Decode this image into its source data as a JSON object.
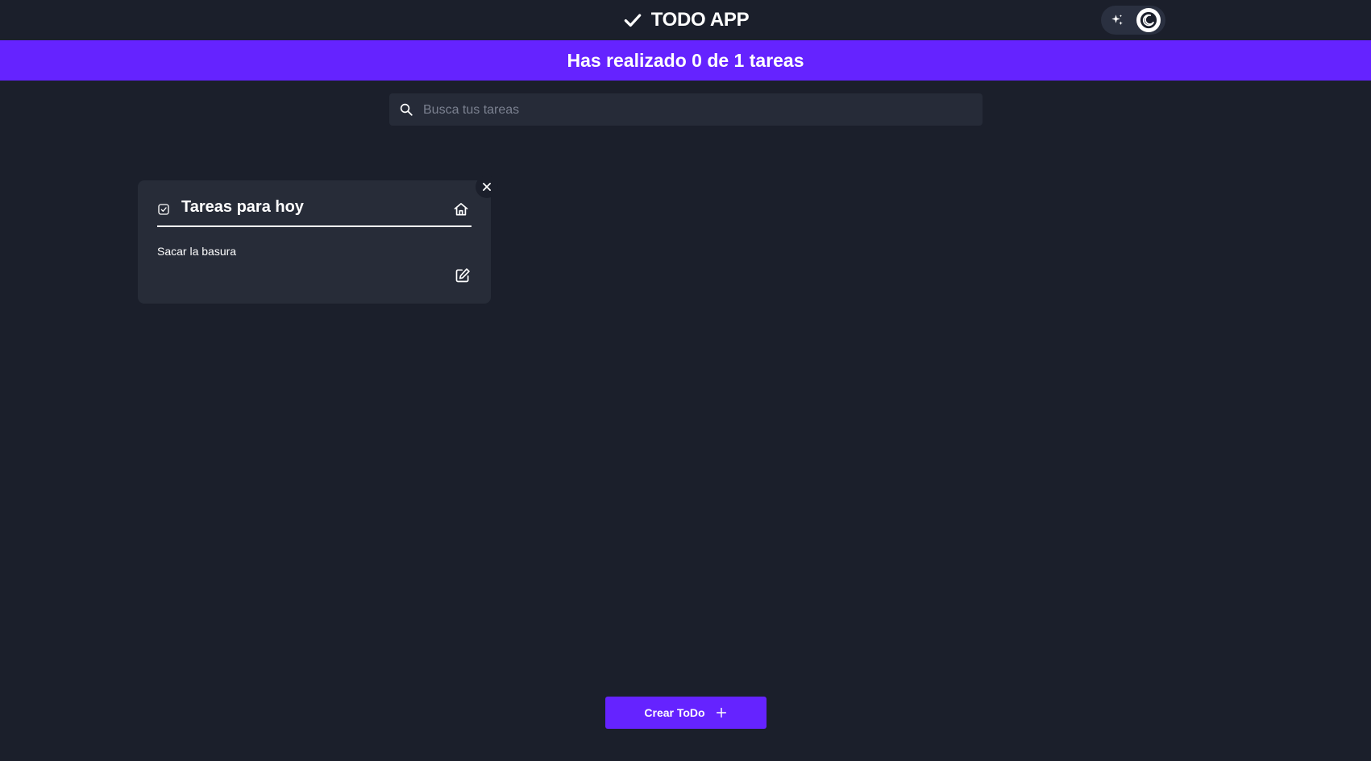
{
  "header": {
    "title": "TODO APP",
    "check_icon": "check-icon",
    "theme_toggle": {
      "light_icon": "sparkle-icon",
      "dark_icon": "moon-icon",
      "active": "dark"
    }
  },
  "progress": {
    "text": "Has realizado 0 de 1 tareas",
    "completed": 0,
    "total": 1
  },
  "search": {
    "placeholder": "Busca tus tareas",
    "value": "",
    "icon": "search-icon"
  },
  "todo_card": {
    "title": "Tareas para hoy",
    "category_icon": "home-icon",
    "status_icon": "checkbox-icon",
    "task": "Sacar la basura",
    "actions": {
      "edit_icon": "edit-icon",
      "delete_icon": "close-icon"
    }
  },
  "create_button": {
    "label": "Crear ToDo",
    "icon": "plus-icon"
  },
  "colors": {
    "background": "#1b1f2b",
    "accent": "#6523ff",
    "card": "#272c38",
    "search": "#262b38",
    "text": "#ffffff",
    "placeholder": "#7b8190"
  }
}
